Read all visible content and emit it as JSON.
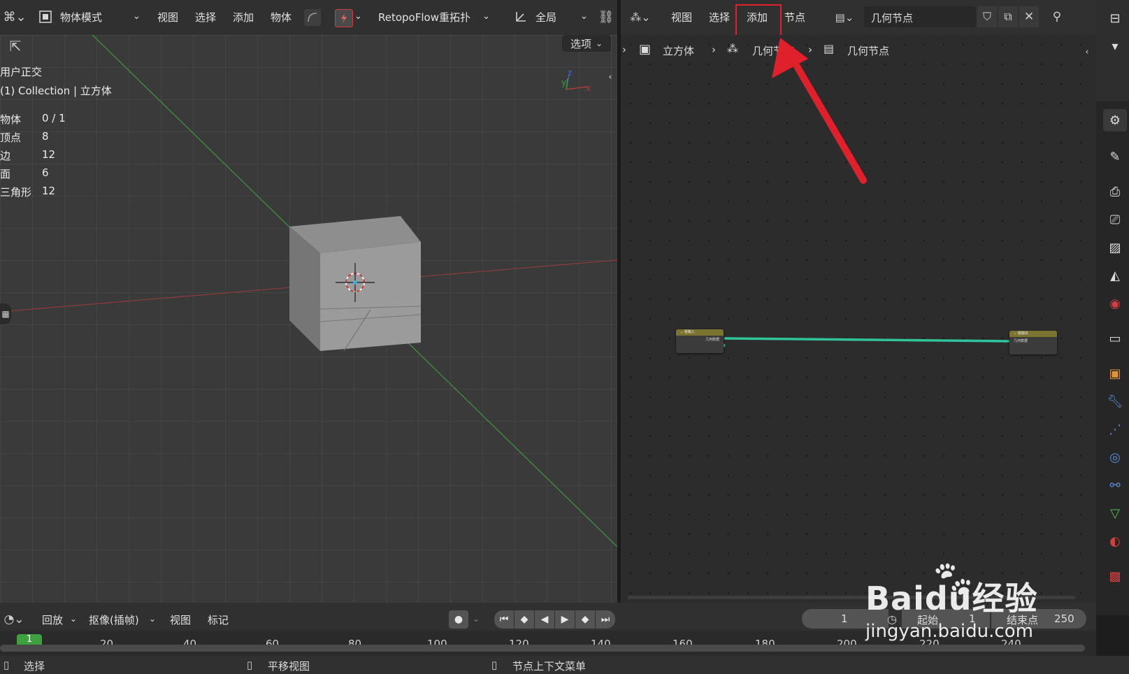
{
  "viewport_header": {
    "mode_label": "物体模式",
    "menu_view": "视图",
    "menu_select": "选择",
    "menu_add": "添加",
    "menu_object": "物体",
    "addon_label": "RetopoFlow重拓扑",
    "transform_label": "全局",
    "options_label": "选项"
  },
  "viewport_overlay": {
    "view_name": "用户正交",
    "collection_line": "(1) Collection | 立方体",
    "stats": [
      {
        "label": "物体",
        "value": "0 / 1"
      },
      {
        "label": "顶点",
        "value": "8"
      },
      {
        "label": "边",
        "value": "12"
      },
      {
        "label": "面",
        "value": "6"
      },
      {
        "label": "三角形",
        "value": "12"
      }
    ]
  },
  "node_editor": {
    "menu_view": "视图",
    "menu_select": "选择",
    "menu_add": "添加",
    "menu_node": "节点",
    "tree_name": "几何节点",
    "breadcrumb": [
      "立方体",
      "几何节点",
      "几何节点"
    ],
    "node_input_title": "组输入",
    "node_input_socket": "几何数据",
    "node_output_title": "组输出",
    "node_output_socket": "几何数据",
    "link_color": "#2fc49a",
    "highlight_color": "#e0202a"
  },
  "timeline": {
    "menu_playback": "回放",
    "menu_keying": "抠像(插帧)",
    "menu_view": "视图",
    "menu_marker": "标记",
    "current_frame": "1",
    "start_label": "起始",
    "start_value": "1",
    "end_label": "结束点",
    "end_value": "250",
    "frame_marker": "1",
    "ticks": [
      "20",
      "40",
      "60",
      "80",
      "100",
      "120",
      "140",
      "160",
      "180",
      "200",
      "220",
      "240"
    ]
  },
  "status_bar": {
    "left_hint": "选择",
    "middle_hint": "平移视图",
    "right_hint": "节点上下文菜单"
  },
  "watermark": {
    "brand": "Baidu经验",
    "url": "jingyan.baidu.com"
  }
}
